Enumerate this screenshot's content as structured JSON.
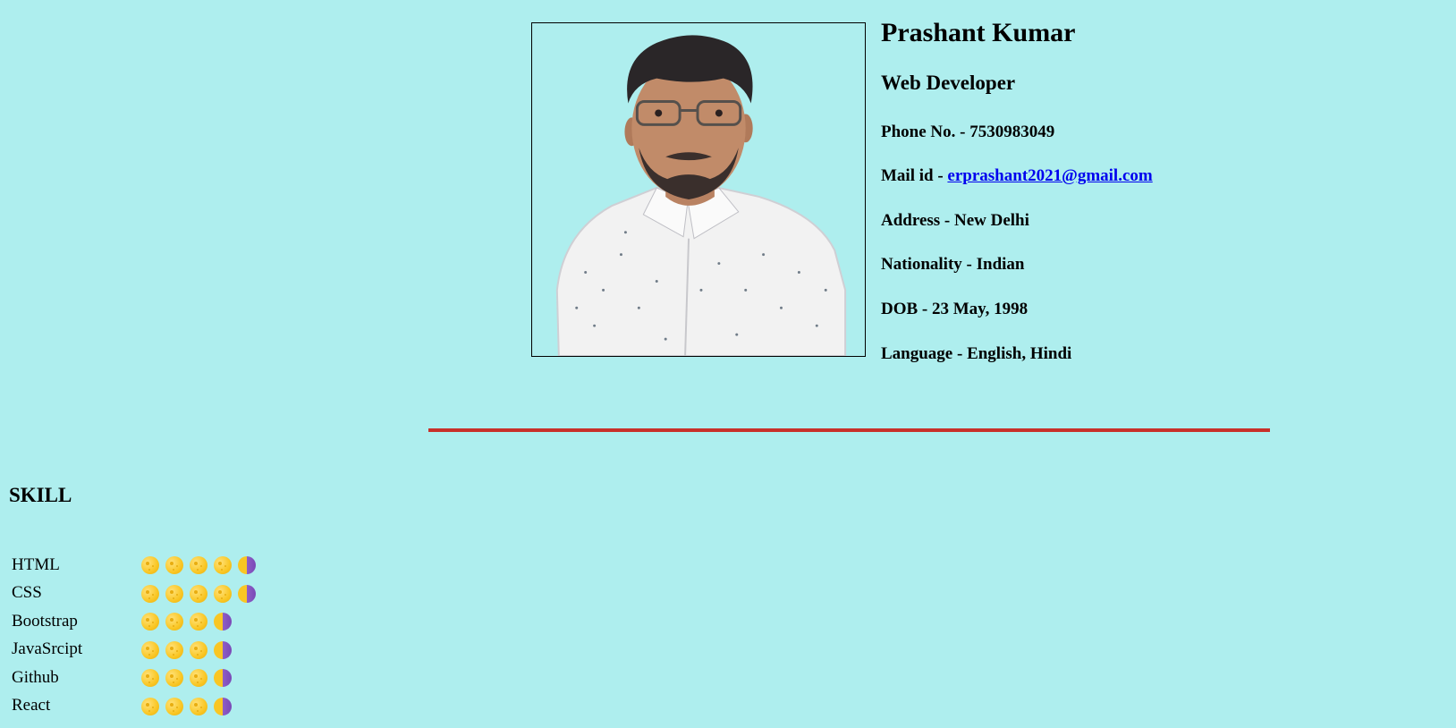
{
  "profile": {
    "name": "Prashant Kumar",
    "title": "Web Developer",
    "phone": "Phone No. - 7530983049",
    "mail_label": "Mail id - ",
    "mail": "erprashant2021@gmail.com",
    "address": "Address - New Delhi",
    "nationality": "Nationality - Indian",
    "dob": "DOB - 23 May, 1998",
    "language": "Language - English, Hindi"
  },
  "colors": {
    "background": "#aeeeee",
    "divider": "#c8302a",
    "link": "#0000ee"
  },
  "skills": {
    "heading": "SKILL",
    "items": [
      {
        "name": "HTML",
        "rating": 4.5
      },
      {
        "name": "CSS",
        "rating": 4.5
      },
      {
        "name": "Bootstrap",
        "rating": 3.5
      },
      {
        "name": "JavaSrcipt",
        "rating": 3.5
      },
      {
        "name": "Github",
        "rating": 3.5
      },
      {
        "name": "React",
        "rating": 3.5
      }
    ]
  }
}
